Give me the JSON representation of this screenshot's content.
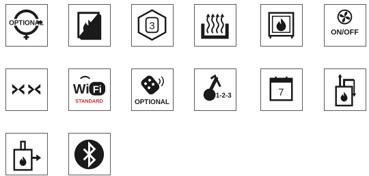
{
  "icons": [
    {
      "name": "optional-plug-icon",
      "label": "OPTIONAL"
    },
    {
      "name": "stove-door-fire-icon"
    },
    {
      "name": "hexagon-three-icon",
      "label": "3"
    },
    {
      "name": "heating-tray-icon"
    },
    {
      "name": "stove-fire-icon"
    },
    {
      "name": "fan-on-off-icon",
      "label": "ON/OFF"
    },
    {
      "name": "airflow-arrows-icon"
    },
    {
      "name": "wifi-standard-icon",
      "wifi_label": "Wi",
      "f_label": "Fi",
      "standard_label": "STANDARD"
    },
    {
      "name": "remote-control-icon",
      "label": "OPTIONAL"
    },
    {
      "name": "thermometer-icon",
      "label": "1-2-3"
    },
    {
      "name": "calendar-icon",
      "label": "7"
    },
    {
      "name": "stove-ducts-icon"
    },
    {
      "name": "stove-pipe-icon"
    },
    {
      "name": "bluetooth-icon"
    }
  ],
  "colors": {
    "border": "#5a5a5a",
    "icon": "#1a1a1a",
    "standard_red": "#d12a2a"
  }
}
